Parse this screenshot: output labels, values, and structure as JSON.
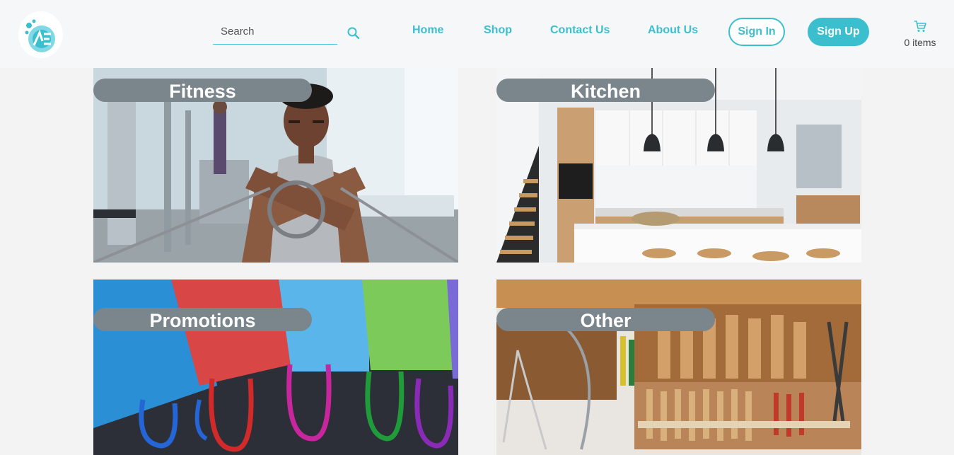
{
  "header": {
    "logo": {
      "icon": "brand-logo-icon",
      "colors": [
        "#3bbfcf",
        "#8fe0ea"
      ]
    },
    "search": {
      "placeholder": "Search",
      "value": "",
      "icon": "search-icon"
    },
    "nav": [
      {
        "label": "Home"
      },
      {
        "label": "Shop"
      },
      {
        "label": "Contact Us"
      },
      {
        "label": "About Us"
      }
    ],
    "sign_in": "Sign In",
    "sign_up": "Sign Up",
    "cart": {
      "icon": "cart-icon",
      "count_label": "0 items"
    }
  },
  "categories": [
    {
      "label": "Fitness",
      "image": "man exercising with cable handles in a gym"
    },
    {
      "label": "Kitchen",
      "image": "modern white kitchen with pendant lights and stools"
    },
    {
      "label": "Promotions",
      "image": "colorful paper shopping bags with ribbon handles"
    },
    {
      "label": "Other",
      "image": "wall of woodworking hand tools"
    }
  ],
  "colors": {
    "accent": "#3bbfcf",
    "pill_bg": "#7a858c",
    "page_bg": "#f3f3f3",
    "header_bg": "#f6f7f8"
  }
}
